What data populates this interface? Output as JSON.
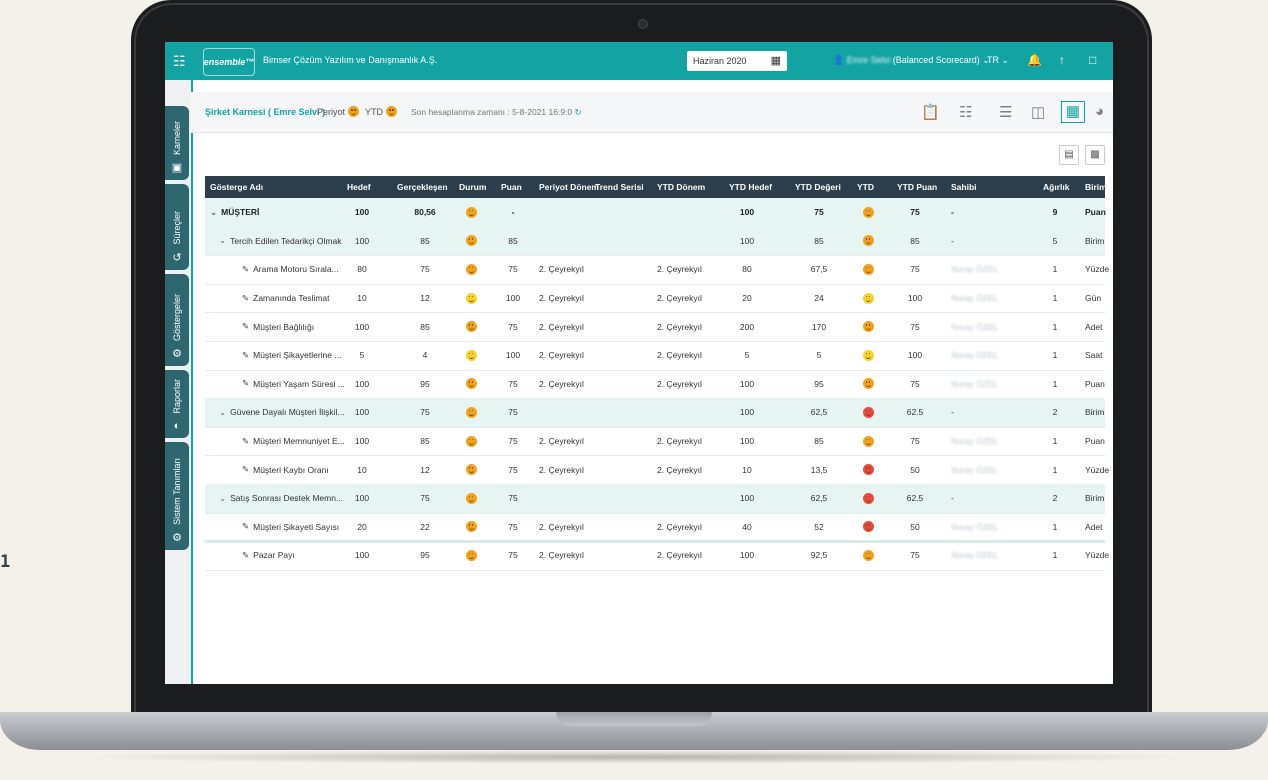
{
  "page_number": "1",
  "topbar": {
    "logo_text": "ensemble™",
    "company": "Bimser Çözüm Yazılım ve Danışmanlık A.Ş.",
    "date_value": "Haziran 2020",
    "user_name": "Emre Selvi",
    "user_role": "(Balanced Scorecard)",
    "language": "TR"
  },
  "sidebar": {
    "items": [
      {
        "label": "Karneler",
        "icon": "scorecard-icon"
      },
      {
        "label": "Süreçler",
        "icon": "process-icon"
      },
      {
        "label": "Göstergeler",
        "icon": "indicator-icon"
      },
      {
        "label": "Raporlar",
        "icon": "report-icon"
      },
      {
        "label": "Sistem Tanımları",
        "icon": "gear-icon"
      }
    ]
  },
  "breadcrumb": {
    "title": "Şirket Karnesi ( Emre Selvi )",
    "period_label": "Periyot",
    "ytd_label": "YTD",
    "last_calc": "Son hesaplanma zamanı : 5-8-2021 16:9:0"
  },
  "table": {
    "columns": [
      "Gösterge Adı",
      "Hedef",
      "Gerçekleşen",
      "Durum",
      "Puan",
      "Periyot Dönem",
      "Trend Serisi",
      "YTD Dönem",
      "YTD Hedef",
      "YTD Değeri",
      "YTD",
      "YTD Puan",
      "Sahibi",
      "Ağırlık",
      "Birim"
    ],
    "rows": [
      {
        "level": 0,
        "name": "MÜŞTERİ",
        "hedef": "100",
        "gercek": "80,56",
        "durum": "orange",
        "puan": "-",
        "periyot": "",
        "ytd_donem": "",
        "ytd_hedef": "100",
        "ytd_deger": "75",
        "ytd": "orange",
        "ytd_puan": "75",
        "sahibi": "-",
        "agirlik": "9",
        "birim": "Puan"
      },
      {
        "level": 1,
        "name": "Tercih Edilen Tedarikçi Olmak",
        "hedef": "100",
        "gercek": "85",
        "durum": "orange",
        "puan": "85",
        "periyot": "",
        "ytd_donem": "",
        "ytd_hedef": "100",
        "ytd_deger": "85",
        "ytd": "orange",
        "ytd_puan": "85",
        "sahibi": "-",
        "agirlik": "5",
        "birim": "Birim"
      },
      {
        "level": 2,
        "name": "Arama Motoru Sırala...",
        "hedef": "80",
        "gercek": "75",
        "durum": "orange",
        "puan": "75",
        "periyot": "2. Çeyrekyıl",
        "ytd_donem": "2. Çeyrekyıl",
        "ytd_hedef": "80",
        "ytd_deger": "67,5",
        "ytd": "orange",
        "ytd_puan": "75",
        "sahibi": "Nuray ÖZEL",
        "agirlik": "1",
        "birim": "Yüzde"
      },
      {
        "level": 2,
        "name": "Zamanında Teslimat",
        "hedef": "10",
        "gercek": "12",
        "durum": "yellow",
        "puan": "100",
        "periyot": "2. Çeyrekyıl",
        "ytd_donem": "2. Çeyrekyıl",
        "ytd_hedef": "20",
        "ytd_deger": "24",
        "ytd": "yellow",
        "ytd_puan": "100",
        "sahibi": "Nuray ÖZEL",
        "agirlik": "1",
        "birim": "Gün"
      },
      {
        "level": 2,
        "name": "Müşteri Bağlılığı",
        "hedef": "100",
        "gercek": "85",
        "durum": "orange",
        "puan": "75",
        "periyot": "2. Çeyrekyıl",
        "ytd_donem": "2. Çeyrekyıl",
        "ytd_hedef": "200",
        "ytd_deger": "170",
        "ytd": "orange",
        "ytd_puan": "75",
        "sahibi": "Nuray ÖZEL",
        "agirlik": "1",
        "birim": "Adet"
      },
      {
        "level": 2,
        "name": "Müşteri Şikayetlerine ...",
        "hedef": "5",
        "gercek": "4",
        "durum": "yellow",
        "puan": "100",
        "periyot": "2. Çeyrekyıl",
        "ytd_donem": "2. Çeyrekyıl",
        "ytd_hedef": "5",
        "ytd_deger": "5",
        "ytd": "yellow",
        "ytd_puan": "100",
        "sahibi": "Nuray ÖZEL",
        "agirlik": "1",
        "birim": "Saat"
      },
      {
        "level": 2,
        "name": "Müşteri Yaşam Süresi ...",
        "hedef": "100",
        "gercek": "95",
        "durum": "orange",
        "puan": "75",
        "periyot": "2. Çeyrekyıl",
        "ytd_donem": "2. Çeyrekyıl",
        "ytd_hedef": "100",
        "ytd_deger": "95",
        "ytd": "orange",
        "ytd_puan": "75",
        "sahibi": "Nuray ÖZEL",
        "agirlik": "1",
        "birim": "Puan"
      },
      {
        "level": 1,
        "name": "Güvene Dayalı Müşteri İlişkil...",
        "hedef": "100",
        "gercek": "75",
        "durum": "orange",
        "puan": "75",
        "periyot": "",
        "ytd_donem": "",
        "ytd_hedef": "100",
        "ytd_deger": "62,5",
        "ytd": "red",
        "ytd_puan": "62.5",
        "sahibi": "-",
        "agirlik": "2",
        "birim": "Birim"
      },
      {
        "level": 2,
        "name": "Müşteri Memnuniyet E...",
        "hedef": "100",
        "gercek": "85",
        "durum": "orange",
        "puan": "75",
        "periyot": "2. Çeyrekyıl",
        "ytd_donem": "2. Çeyrekyıl",
        "ytd_hedef": "100",
        "ytd_deger": "85",
        "ytd": "orange",
        "ytd_puan": "75",
        "sahibi": "Nuray ÖZEL",
        "agirlik": "1",
        "birim": "Puan"
      },
      {
        "level": 2,
        "name": "Müşteri Kaybı Oranı",
        "hedef": "10",
        "gercek": "12",
        "durum": "orange",
        "puan": "75",
        "periyot": "2. Çeyrekyıl",
        "ytd_donem": "2. Çeyrekyıl",
        "ytd_hedef": "10",
        "ytd_deger": "13,5",
        "ytd": "red",
        "ytd_puan": "50",
        "sahibi": "Nuray ÖZEL",
        "agirlik": "1",
        "birim": "Yüzde"
      },
      {
        "level": 1,
        "name": "Satış Sonrası Destek Memn...",
        "hedef": "100",
        "gercek": "75",
        "durum": "orange",
        "puan": "75",
        "periyot": "",
        "ytd_donem": "",
        "ytd_hedef": "100",
        "ytd_deger": "62,5",
        "ytd": "red",
        "ytd_puan": "62.5",
        "sahibi": "-",
        "agirlik": "2",
        "birim": "Birim"
      },
      {
        "level": 2,
        "name": "Müşteri Şikayeti Sayısı",
        "hedef": "20",
        "gercek": "22",
        "durum": "orange",
        "puan": "75",
        "periyot": "2. Çeyrekyıl",
        "ytd_donem": "2. Çeyrekyıl",
        "ytd_hedef": "40",
        "ytd_deger": "52",
        "ytd": "red",
        "ytd_puan": "50",
        "sahibi": "Nuray ÖZEL",
        "agirlik": "1",
        "birim": "Adet"
      },
      {
        "level": 2,
        "name": "Pazar Payı",
        "hedef": "100",
        "gercek": "95",
        "durum": "orange",
        "puan": "75",
        "periyot": "2. Çeyrekyıl",
        "ytd_donem": "2. Çeyrekyıl",
        "ytd_hedef": "100",
        "ytd_deger": "92,5",
        "ytd": "orange",
        "ytd_puan": "75",
        "sahibi": "Nuray ÖZEL",
        "agirlik": "1",
        "birim": "Yüzde"
      }
    ]
  },
  "colors": {
    "accent": "#14a3a3",
    "header": "#2c3e4c",
    "group_row": "#e6f4f2"
  }
}
